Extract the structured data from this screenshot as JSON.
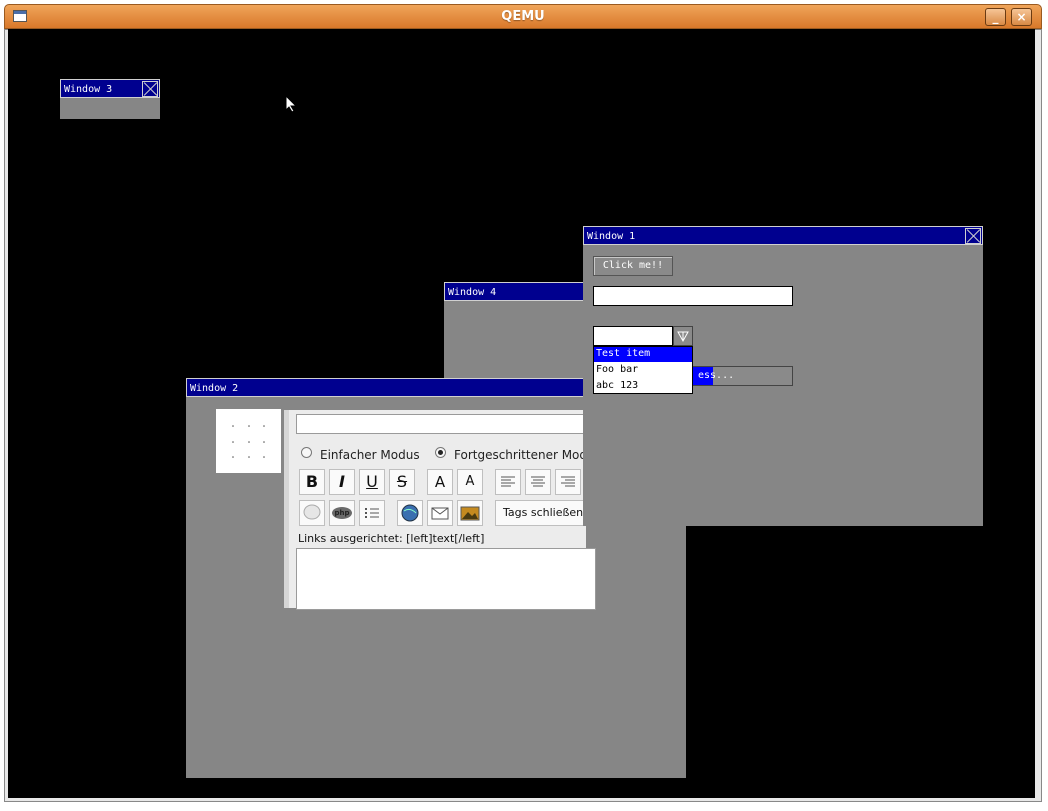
{
  "host": {
    "title": "QEMU",
    "buttons": {
      "minimize": "_",
      "close": "×"
    }
  },
  "window3": {
    "title": "Window 3"
  },
  "window4": {
    "title": "Window 4"
  },
  "window2": {
    "title": "Window 2",
    "editor": {
      "mode_simple": "Einfacher Modus",
      "mode_advanced": "Fortgeschrittener Modus",
      "tags_close": "Tags schließen",
      "status": "Links ausgerichtet: [left]text[/left]",
      "buttons": {
        "bold": "B",
        "italic": "I",
        "underline": "U",
        "strike": "S",
        "font_down": "A",
        "font_up": "A"
      },
      "php_label": "php"
    }
  },
  "window1": {
    "title": "Window 1",
    "click_button": "Click me!!",
    "dropdown_items": [
      "Test item",
      "Foo bar",
      "abc 123"
    ],
    "progress_text": "ess...",
    "progress": 0.6
  }
}
